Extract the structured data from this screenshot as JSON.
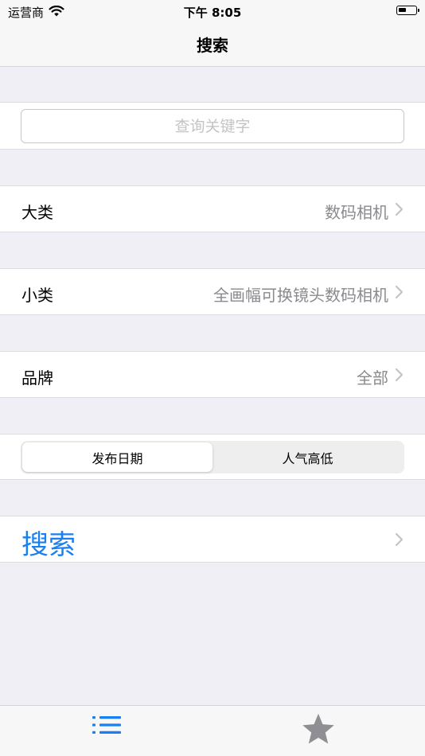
{
  "status_bar": {
    "carrier": "运营商",
    "time": "下午 8:05",
    "battery_level": 0.45
  },
  "nav": {
    "title": "搜索"
  },
  "search": {
    "placeholder": "查询关键字",
    "value": ""
  },
  "filters": {
    "category": {
      "label": "大类",
      "value": "数码相机"
    },
    "subcategory": {
      "label": "小类",
      "value": "全画幅可换镜头数码相机"
    },
    "brand": {
      "label": "品牌",
      "value": "全部"
    }
  },
  "sort": {
    "options": [
      "发布日期",
      "人气高低"
    ],
    "selected_index": 0
  },
  "search_action": {
    "label": "搜索"
  },
  "tabs": [
    {
      "icon": "list-icon",
      "selected": true
    },
    {
      "icon": "star-icon",
      "selected": false
    }
  ],
  "colors": {
    "accent": "#1a7ff0",
    "background": "#f0eff5",
    "secondary_text": "#8a8a8e",
    "tab_inactive": "#8e8e93"
  }
}
